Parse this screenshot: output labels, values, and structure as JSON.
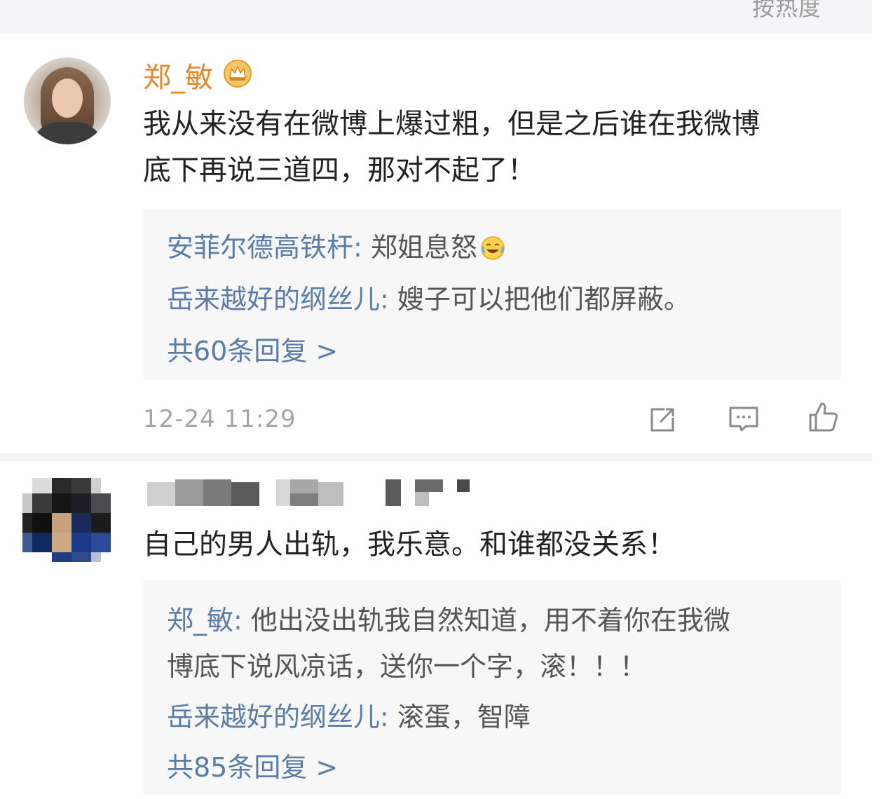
{
  "header": {
    "sort_label": "按热度"
  },
  "comments": [
    {
      "username": "郑_敏",
      "content": "我从来没有在微博上爆过粗，但是之后谁在我微博底下再说三道四，那对不起了！",
      "content_lines": [
        "我从来没有在微博上爆过粗，但是之后谁在我微博",
        "底下再说三道四，那对不起了！"
      ],
      "replies": [
        {
          "name": "安菲尔德高铁杆:",
          "text": " 郑姐息怒"
        },
        {
          "name": "岳来越好的纲丝儿:",
          "text": " 嫂子可以把他们都屏蔽。"
        }
      ],
      "reply_count": "共60条回复 >",
      "timestamp": "12-24 11:29"
    },
    {
      "username": "",
      "content": "自己的男人出轨，我乐意。和谁都没关系！",
      "replies": [
        {
          "name": "郑_敏:",
          "text": " 他出没出轨我自然知道，用不着你在我微",
          "text2": "博底下说风凉话，送你一个字，滚！！！"
        },
        {
          "name": "岳来越好的纲丝儿:",
          "text": " 滚蛋，智障"
        }
      ],
      "reply_count": "共85条回复 >"
    }
  ],
  "colors": {
    "username": "#e28a2a",
    "reply_name": "#5a7da6",
    "timestamp": "#a5a5a5",
    "reply_bg": "#f7f7f7"
  },
  "icons": [
    "crown-icon",
    "laugh-emoji-icon",
    "repost-icon",
    "comment-icon",
    "like-icon"
  ]
}
